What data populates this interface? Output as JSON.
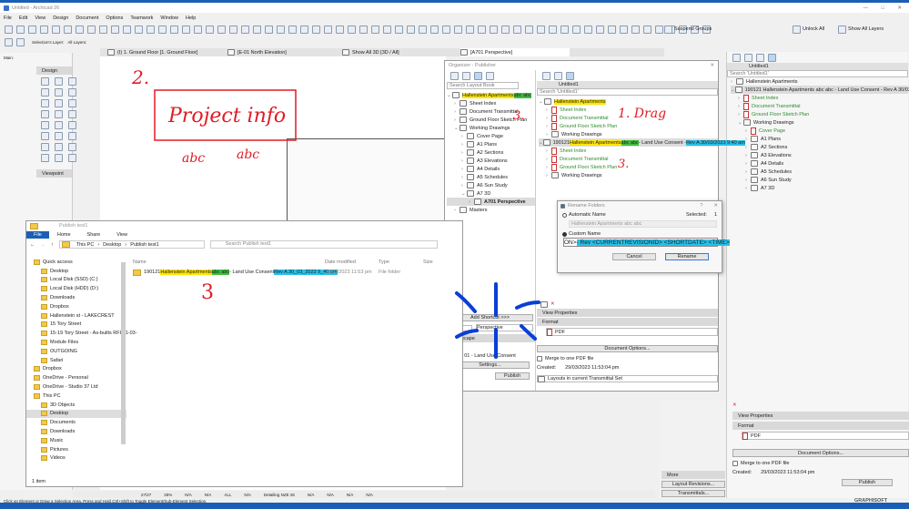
{
  "app": {
    "title": "Untitled - Archicad 26",
    "menu": [
      "File",
      "Edit",
      "View",
      "Design",
      "Document",
      "Options",
      "Teamwork",
      "Window",
      "Help"
    ],
    "toolbar": {
      "selection_layer": "Selection's Layer:",
      "all_layers": "All Layers:",
      "suspend_groups": "Suspend Groups",
      "unlock_all": "Unlock All",
      "show_all_layers": "Show All Layers"
    },
    "tabs": [
      "(I) 1. Ground Floor [1. Ground Floor]",
      "[E-01 North Elevation]",
      "Show All 3D [3D / All]",
      "[A701 Perspective]"
    ],
    "toolbox": {
      "main": "Main:",
      "design": "Design",
      "viewpoint": "Viewpoint"
    },
    "annotation_text": [
      "2.",
      "Project info",
      "abc",
      "abc"
    ]
  },
  "organizer": {
    "title": "Organizer - Publisher",
    "search_layout": "Search Layout Book",
    "left_tree": [
      {
        "label": "Hallenstein Apartments",
        "hl2": "abc abc",
        "icon": "layout",
        "level": 0,
        "open": true,
        "selected": false
      },
      {
        "label": "Sheet Index",
        "icon": "layout",
        "level": 1
      },
      {
        "label": "Document Transmittal",
        "icon": "layout",
        "level": 1
      },
      {
        "label": "Ground Floor Sketch Plan",
        "icon": "layout",
        "level": 1
      },
      {
        "label": "Working Drawings",
        "icon": "folder",
        "level": 1,
        "open": true
      },
      {
        "label": "Cover Page",
        "icon": "layout",
        "level": 2
      },
      {
        "label": "A1 Plans",
        "icon": "folder",
        "level": 2
      },
      {
        "label": "A2 Sections",
        "icon": "folder",
        "level": 2
      },
      {
        "label": "A3 Elevations",
        "icon": "folder",
        "level": 2
      },
      {
        "label": "A4 Details",
        "icon": "folder",
        "level": 2
      },
      {
        "label": "A5 Schedules",
        "icon": "folder",
        "level": 2
      },
      {
        "label": "A6 Sun Study",
        "icon": "folder",
        "level": 2
      },
      {
        "label": "A7 3D",
        "icon": "folder",
        "level": 2,
        "open": true
      },
      {
        "label": "A701 Perspective",
        "icon": "layout",
        "level": 3,
        "selected": true
      },
      {
        "label": "Masters",
        "icon": "folder",
        "level": 1
      }
    ],
    "set_name": "Untitled1",
    "search_set": "Search 'Untitled1'",
    "right_tree": [
      {
        "label": "Hallenstein Apartments",
        "icon": "folder",
        "level": 0,
        "open": true,
        "hl": "y"
      },
      {
        "label": "Sheet Index",
        "icon": "pdf",
        "level": 1,
        "green": true
      },
      {
        "label": "Document Transmittal",
        "icon": "pdf",
        "level": 1,
        "green": true
      },
      {
        "label": "Ground Floor Sketch Plan",
        "icon": "pdf",
        "level": 1,
        "green": true
      },
      {
        "label": "Working Drawings",
        "icon": "folder",
        "level": 1
      },
      {
        "prefix": "190121 ",
        "label": "Hallenstein Apartments",
        "hl2": "abc abc",
        "mid": " - Land Use Consent - ",
        "hl3": "Rev A 30/03/2023 9:40 am",
        "icon": "folder",
        "level": 0,
        "open": true,
        "selected": true
      },
      {
        "label": "Sheet Index",
        "icon": "pdf",
        "level": 1,
        "green": true
      },
      {
        "label": "Document Transmittal",
        "icon": "pdf",
        "level": 1,
        "green": true
      },
      {
        "label": "Ground Floor Sketch Plan",
        "icon": "pdf",
        "level": 1,
        "green": true
      },
      {
        "label": "Working Drawings",
        "icon": "folder",
        "level": 1
      }
    ],
    "add_shortcut": "Add Shortcut >>>",
    "perspective": "Perspective",
    "landscape": "Landscape",
    "size_val": "594",
    "revision": "01 - Land Use Consent",
    "settings": "Settings...",
    "view_properties": "View Properties",
    "format": "Format",
    "format_value": "PDF",
    "document_options": "Document Options...",
    "merge_pdf": "Merge to one PDF file",
    "created_label": "Created:",
    "created_value": "29/03/2023 11:53:04 pm",
    "publish": "Publish",
    "publish_scope": "Layouts in current Transmittal Set",
    "annotations": [
      "3.",
      "1. Drag",
      "3."
    ]
  },
  "rename": {
    "title": "Rename Folders",
    "help": "?",
    "automatic_name": "Automatic Name",
    "selected_label": "Selected:",
    "selected_count": "1",
    "auto_value": "Hallenstein Apartments  abc abc",
    "custom_name": "Custom Name",
    "custom_prefix": "ON> ",
    "custom_value": "- Rev <CURRENTREVISIONID> <SHORTDATE> <TIME>",
    "cancel": "Cancel",
    "rename": "Rename"
  },
  "explorer": {
    "title": "Publish test1",
    "ribbon": [
      "File",
      "Home",
      "Share",
      "View"
    ],
    "path": [
      "This PC",
      "Desktop",
      "Publish test1"
    ],
    "search": "Search Publish test1",
    "columns": [
      "Name",
      "Date modified",
      "Type",
      "Size"
    ],
    "file": {
      "prefix": "190121 ",
      "hl1": "Hallenstein Apartments",
      "hl2": "abc abc",
      "mid": " - Land Use Consent ",
      "hl3": "Rev A  30_03_2023 9_40 am",
      "date": "29/03/2023 11:53 pm",
      "type": "File folder"
    },
    "annotation": "3",
    "nav": [
      {
        "label": "Quick access",
        "level": 0
      },
      {
        "label": "Desktop",
        "level": 1
      },
      {
        "label": "Local Disk (SSD) (C:)",
        "level": 1
      },
      {
        "label": "Local Disk (HDD) (D:)",
        "level": 1
      },
      {
        "label": "Downloads",
        "level": 1
      },
      {
        "label": "Dropbox",
        "level": 1
      },
      {
        "label": "Hallenstein st - LAKECREST",
        "level": 1
      },
      {
        "label": "15 Tory Street",
        "level": 1
      },
      {
        "label": "15-19 Tory Street - As-builts RFI 21-03-",
        "level": 1
      },
      {
        "label": "Module Files",
        "level": 1
      },
      {
        "label": "OUTGOING",
        "level": 1
      },
      {
        "label": "Safari",
        "level": 1
      },
      {
        "label": "Dropbox",
        "level": 0
      },
      {
        "label": "OneDrive - Personal",
        "level": 0
      },
      {
        "label": "OneDrive - Studio 37 Ltd",
        "level": 0
      },
      {
        "label": "This PC",
        "level": 0
      },
      {
        "label": "3D Objects",
        "level": 1
      },
      {
        "label": "Desktop",
        "level": 1,
        "selected": true
      },
      {
        "label": "Documents",
        "level": 1
      },
      {
        "label": "Downloads",
        "level": 1
      },
      {
        "label": "Music",
        "level": 1
      },
      {
        "label": "Pictures",
        "level": 1
      },
      {
        "label": "Videos",
        "level": 1
      }
    ],
    "status": "1 item"
  },
  "right_panel": {
    "set_name": "Untitled1",
    "search": "Search 'Untitled1'",
    "tree": [
      {
        "label": "Hallenstein Apartments",
        "icon": "folder",
        "level": 0
      },
      {
        "label": "190121 Hallenstein Apartments  abc abc - Land Use Consent - Rev A 30/03/2023 9:40 am",
        "icon": "folder",
        "level": 0,
        "open": true,
        "selected": true
      },
      {
        "label": "Sheet Index",
        "icon": "pdf",
        "level": 1,
        "green": true
      },
      {
        "label": "Document Transmittal",
        "icon": "pdf",
        "level": 1,
        "green": true
      },
      {
        "label": "Ground Floor Sketch Plan",
        "icon": "pdf",
        "level": 1,
        "green": true
      },
      {
        "label": "Working Drawings",
        "icon": "folder",
        "level": 1,
        "open": true
      },
      {
        "label": "Cover Page",
        "icon": "pdf",
        "level": 2,
        "green": true
      },
      {
        "label": "A1 Plans",
        "icon": "folder",
        "level": 2
      },
      {
        "label": "A2 Sections",
        "icon": "folder",
        "level": 2
      },
      {
        "label": "A3 Elevations",
        "icon": "folder",
        "level": 2
      },
      {
        "label": "A4 Details",
        "icon": "folder",
        "level": 2
      },
      {
        "label": "A5 Schedules",
        "icon": "folder",
        "level": 2
      },
      {
        "label": "A6 Sun Study",
        "icon": "folder",
        "level": 2
      },
      {
        "label": "A7 3D",
        "icon": "folder",
        "level": 2
      }
    ],
    "view_properties": "View Properties",
    "format": "Format",
    "format_value": "PDF",
    "document_options": "Document Options...",
    "merge_pdf": "Merge to one PDF file",
    "created_label": "Created:",
    "created_value": "29/03/2023 11:53:04 pm",
    "publish": "Publish",
    "more": "More",
    "layout_revisions": "Layout Revisions...",
    "transmittals": "Transmittals...",
    "brand": "GRAPHISOFT"
  },
  "statusbar": {
    "page": "27/27",
    "zoom": "25%",
    "na": "N/A",
    "all": "ALL",
    "detailing": "Detailing NZE 26",
    "hint": "Click an Element or Draw a Selection Area. Press and Hold Ctrl+Shift to Toggle Element/Sub-Element Selection."
  },
  "colors": {
    "highlight_yellow": "#ffe600",
    "highlight_green": "#3fbf3f",
    "highlight_cyan": "#27c0e8",
    "annotation_red": "#e01b24",
    "annotation_blue": "#0a3fd6",
    "layout_green": "#2e8b2e"
  }
}
